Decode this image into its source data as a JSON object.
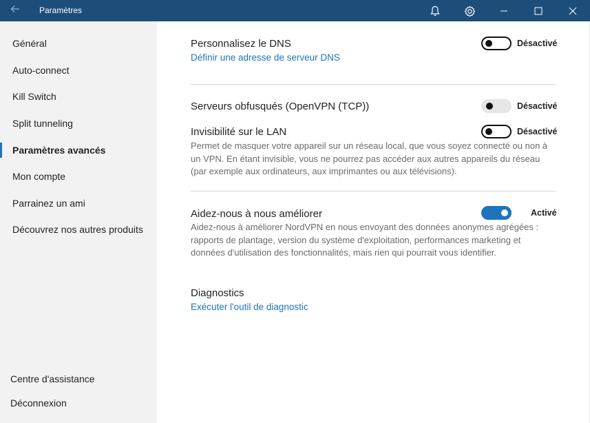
{
  "window": {
    "title": "Paramètres",
    "icons": [
      "back-arrow-icon",
      "bell-icon",
      "gear-icon",
      "minimize-icon",
      "maximize-icon",
      "close-icon"
    ]
  },
  "sidebar": {
    "items": [
      {
        "label": "Général"
      },
      {
        "label": "Auto-connect"
      },
      {
        "label": "Kill Switch"
      },
      {
        "label": "Split tunneling"
      },
      {
        "label": "Paramètres avancés",
        "active": true
      },
      {
        "label": "Mon compte"
      },
      {
        "label": "Parrainez un ami"
      },
      {
        "label": "Découvrez nos autres produits"
      }
    ],
    "help": "Centre d'assistance",
    "logout": "Déconnexion"
  },
  "settings": {
    "dns": {
      "title": "Personnalisez le DNS",
      "link": "Définir une adresse de serveur DNS",
      "state": "Désactivé"
    },
    "obfuscated": {
      "title": "Serveurs obfusqués (OpenVPN (TCP))",
      "state": "Désactivé"
    },
    "lan": {
      "title": "Invisibilité sur le LAN",
      "state": "Désactivé",
      "description": "Permet de masquer votre appareil sur un réseau local, que vous soyez connecté ou non à un VPN. En étant invisible, vous ne pourrez pas accéder aux autres appareils du réseau (par exemple aux ordinateurs, aux imprimantes ou aux télévisions)."
    },
    "improve": {
      "title": "Aidez-nous à nous améliorer",
      "state": "Activé",
      "description": "Aidez-nous à améliorer NordVPN en nous envoyant des données anonymes agrégées : rapports de plantage, version du système d'exploitation, performances marketing et données d'utilisation des fonctionnalités, mais rien qui pourrait vous identifier."
    },
    "diagnostics": {
      "title": "Diagnostics",
      "link": "Exécuter l'outil de diagnostic"
    }
  },
  "colors": {
    "titlebar": "#1d4e7a",
    "accent": "#1e73be",
    "sidebar": "#f2f2f2"
  }
}
